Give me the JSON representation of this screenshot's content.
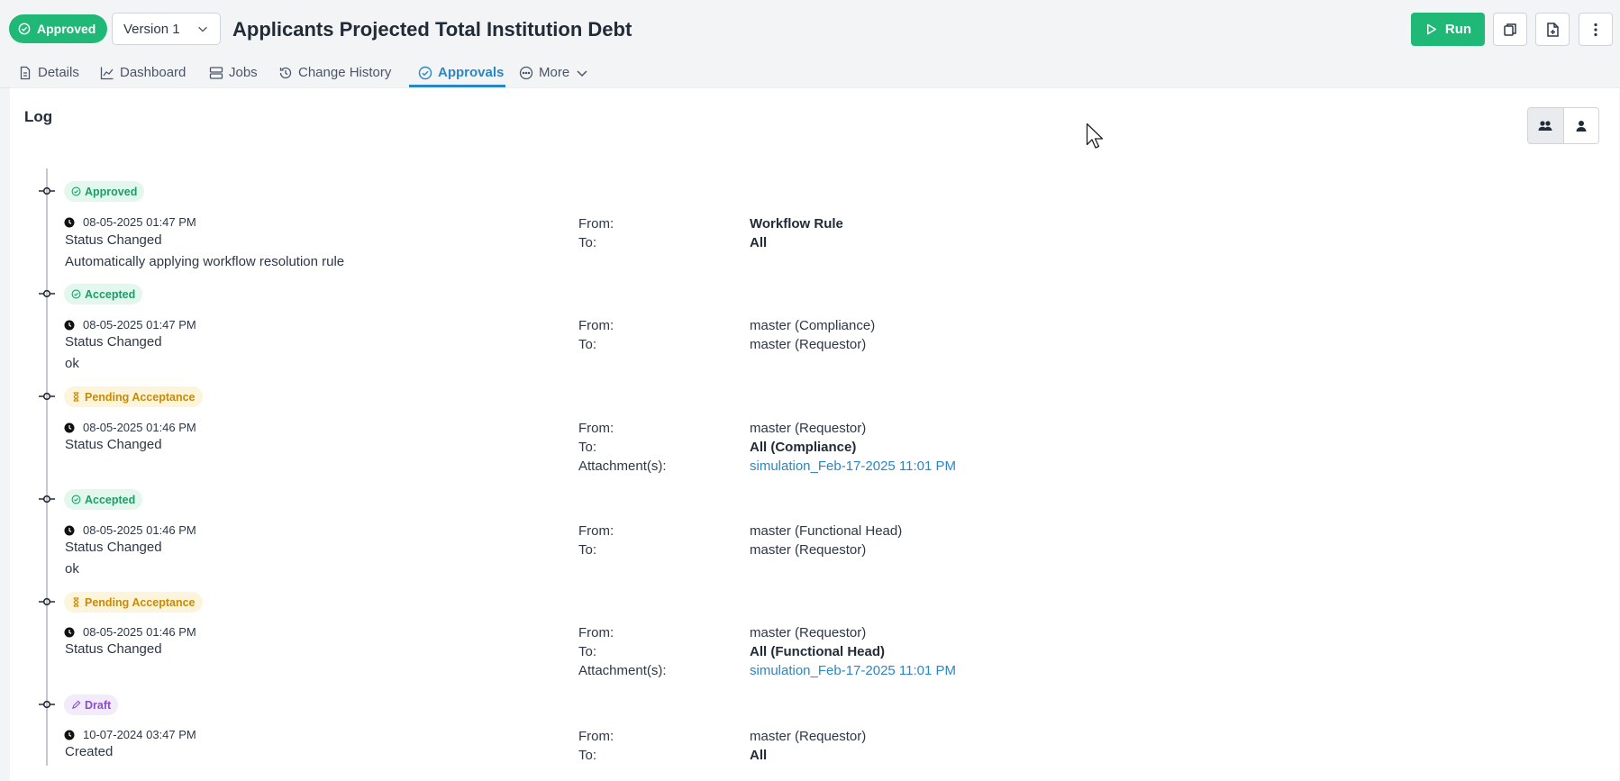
{
  "header": {
    "status": "Approved",
    "version": "Version 1",
    "title": "Applicants Projected Total Institution Debt",
    "run_label": "Run"
  },
  "tabs": [
    {
      "label": "Details",
      "icon": "document-icon"
    },
    {
      "label": "Dashboard",
      "icon": "chart-icon"
    },
    {
      "label": "Jobs",
      "icon": "server-icon"
    },
    {
      "label": "Change History",
      "icon": "history-icon"
    },
    {
      "label": "Approvals",
      "icon": "check-circle-icon",
      "active": true
    },
    {
      "label": "More",
      "icon": "more-icon"
    }
  ],
  "log": {
    "title": "Log",
    "entries": [
      {
        "badge": "Approved",
        "badge_type": "approved",
        "timestamp": "08-05-2025 01:47 PM",
        "action": "Status Changed",
        "note": "Automatically applying workflow resolution rule",
        "from_label": "From:",
        "from": "Workflow Rule",
        "to_label": "To:",
        "to": "All"
      },
      {
        "badge": "Accepted",
        "badge_type": "accepted",
        "timestamp": "08-05-2025 01:47 PM",
        "action": "Status Changed",
        "note": "ok",
        "from_label": "From:",
        "from": "master (Compliance)",
        "to_label": "To:",
        "to": "master (Requestor)"
      },
      {
        "badge": "Pending Acceptance",
        "badge_type": "pending",
        "timestamp": "08-05-2025 01:46 PM",
        "action": "Status Changed",
        "from_label": "From:",
        "from": "master (Requestor)",
        "to_label": "To:",
        "to": "All (Compliance)",
        "attachment_label": "Attachment(s):",
        "attachment": "simulation_Feb-17-2025 11:01 PM"
      },
      {
        "badge": "Accepted",
        "badge_type": "accepted",
        "timestamp": "08-05-2025 01:46 PM",
        "action": "Status Changed",
        "note": "ok",
        "from_label": "From:",
        "from": "master (Functional Head)",
        "to_label": "To:",
        "to": "master (Requestor)"
      },
      {
        "badge": "Pending Acceptance",
        "badge_type": "pending",
        "timestamp": "08-05-2025 01:46 PM",
        "action": "Status Changed",
        "from_label": "From:",
        "from": "master (Requestor)",
        "to_label": "To:",
        "to": "All (Functional Head)",
        "attachment_label": "Attachment(s):",
        "attachment": "simulation_Feb-17-2025 11:01 PM"
      },
      {
        "badge": "Draft",
        "badge_type": "draft",
        "timestamp": "10-07-2024 03:47 PM",
        "action": "Created",
        "from_label": "From:",
        "from": "master (Requestor)",
        "to_label": "To:",
        "to": "All"
      }
    ]
  },
  "colors": {
    "brand_green": "#1fb877",
    "active_tab": "#2b86c5",
    "pending": "#c98a06",
    "draft": "#8a4fc4"
  }
}
